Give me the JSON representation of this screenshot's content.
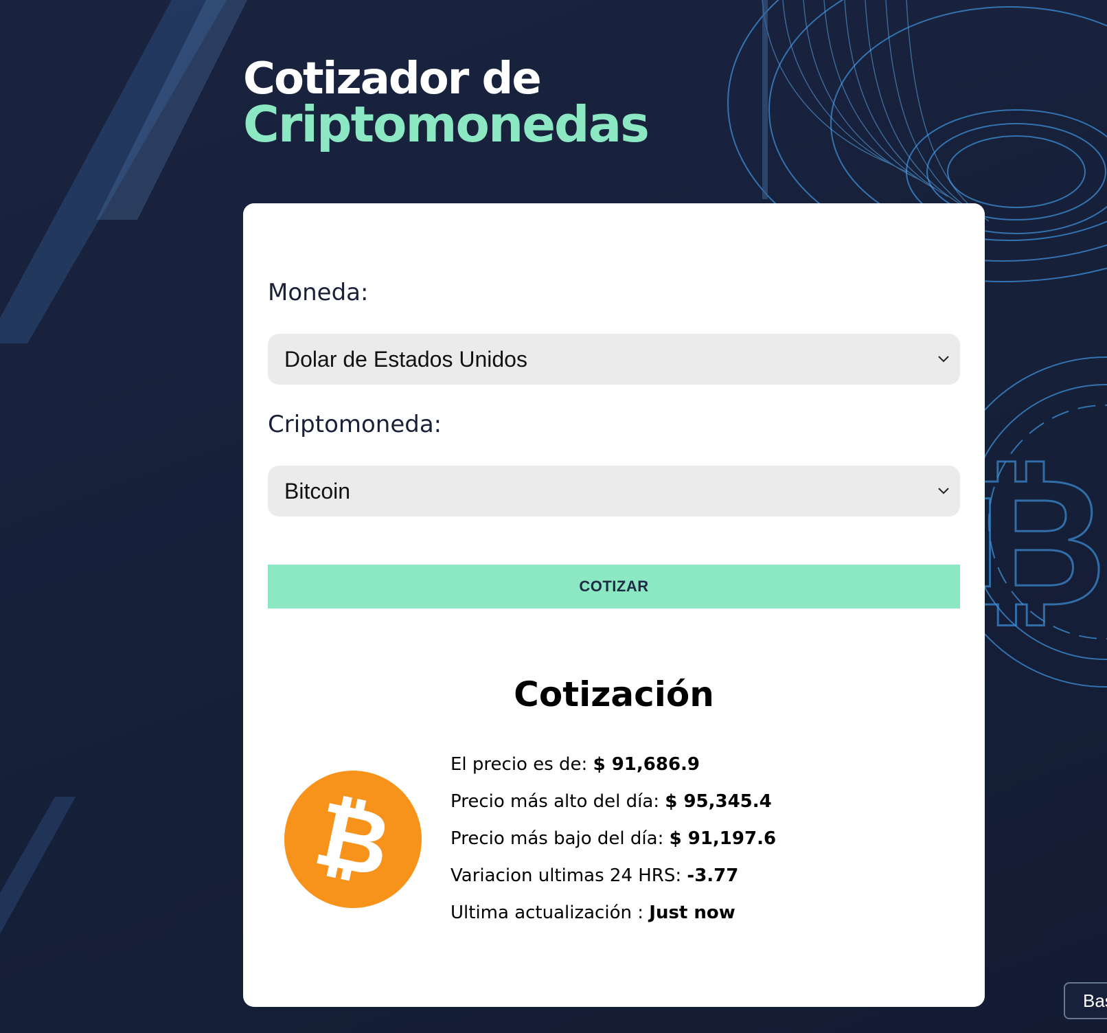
{
  "header": {
    "title_line1": "Cotizador de",
    "title_line2": "Criptomonedas"
  },
  "form": {
    "currency_label": "Moneda:",
    "currency_selected": "Dolar de Estados Unidos",
    "crypto_label": "Criptomoneda:",
    "crypto_selected": "Bitcoin",
    "submit_label": "COTIZAR"
  },
  "result": {
    "title": "Cotización",
    "coin_icon": "bitcoin-icon",
    "price_label": "El precio es de:",
    "price_value": "$ 91,686.9",
    "high_label": "Precio más alto del día:",
    "high_value": "$ 95,345.4",
    "low_label": "Precio más bajo del día:",
    "low_value": "$ 91,197.6",
    "change_label": "Variacion ultimas 24 HRS:",
    "change_value": "-3.77",
    "updated_label": "Ultima actualización :",
    "updated_value": "Just now"
  },
  "corner_button": {
    "label": "Bas"
  },
  "colors": {
    "accent": "#8be8c2",
    "background": "#172036",
    "bitcoin": "#f7931a"
  }
}
